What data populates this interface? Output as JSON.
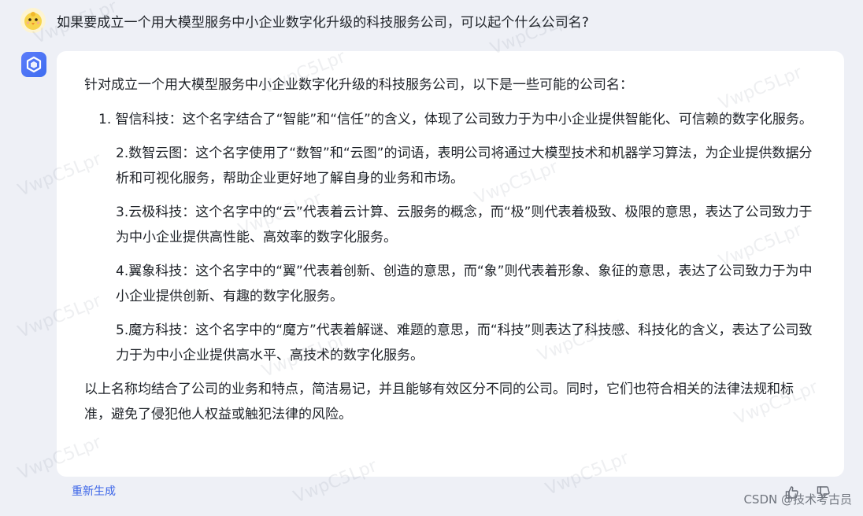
{
  "conversation": {
    "question": "如果要成立一个用大模型服务中小企业数字化升级的科技服务公司，可以起个什么公司名?",
    "answer": {
      "intro": "针对成立一个用大模型服务中小企业数字化升级的科技服务公司，以下是一些可能的公司名：",
      "items": [
        {
          "num": "1. ",
          "text": "智信科技：这个名字结合了“智能”和“信任”的含义，体现了公司致力于为中小企业提供智能化、可信赖的数字化服务。"
        },
        {
          "num": "",
          "text": "2.数智云图：这个名字使用了“数智”和“云图”的词语，表明公司将通过大模型技术和机器学习算法，为企业提供数据分析和可视化服务，帮助企业更好地了解自身的业务和市场。"
        },
        {
          "num": "",
          "text": "3.云极科技：这个名字中的“云”代表着云计算、云服务的概念，而“极”则代表着极致、极限的意思，表达了公司致力于为中小企业提供高性能、高效率的数字化服务。"
        },
        {
          "num": "",
          "text": "4.翼象科技：这个名字中的“翼”代表着创新、创造的意思，而“象”则代表着形象、象征的意思，表达了公司致力于为中小企业提供创新、有趣的数字化服务。"
        },
        {
          "num": "",
          "text": "5.魔方科技：这个名字中的“魔方”代表着解谜、难题的意思，而“科技”则表达了科技感、科技化的含义，表达了公司致力于为中小企业提供高水平、高技术的数字化服务。"
        }
      ],
      "summary": "以上名称均结合了公司的业务和特点，简洁易记，并且能够有效区分不同的公司。同时，它们也符合相关的法律法规和标准，避免了侵犯他人权益或触犯法律的风险。"
    }
  },
  "actions": {
    "regenerate_label": "重新生成"
  },
  "footer": {
    "credit": "CSDN @技术考古员"
  },
  "watermark": "VwpC5Lpr",
  "icons": {
    "user_avatar": "chick-avatar-icon",
    "bot_avatar": "cube-logo-icon",
    "like": "thumb-up-icon",
    "dislike": "thumb-down-icon"
  },
  "colors": {
    "background": "#eef0f6",
    "card": "#ffffff",
    "accent": "#3d66e8"
  }
}
